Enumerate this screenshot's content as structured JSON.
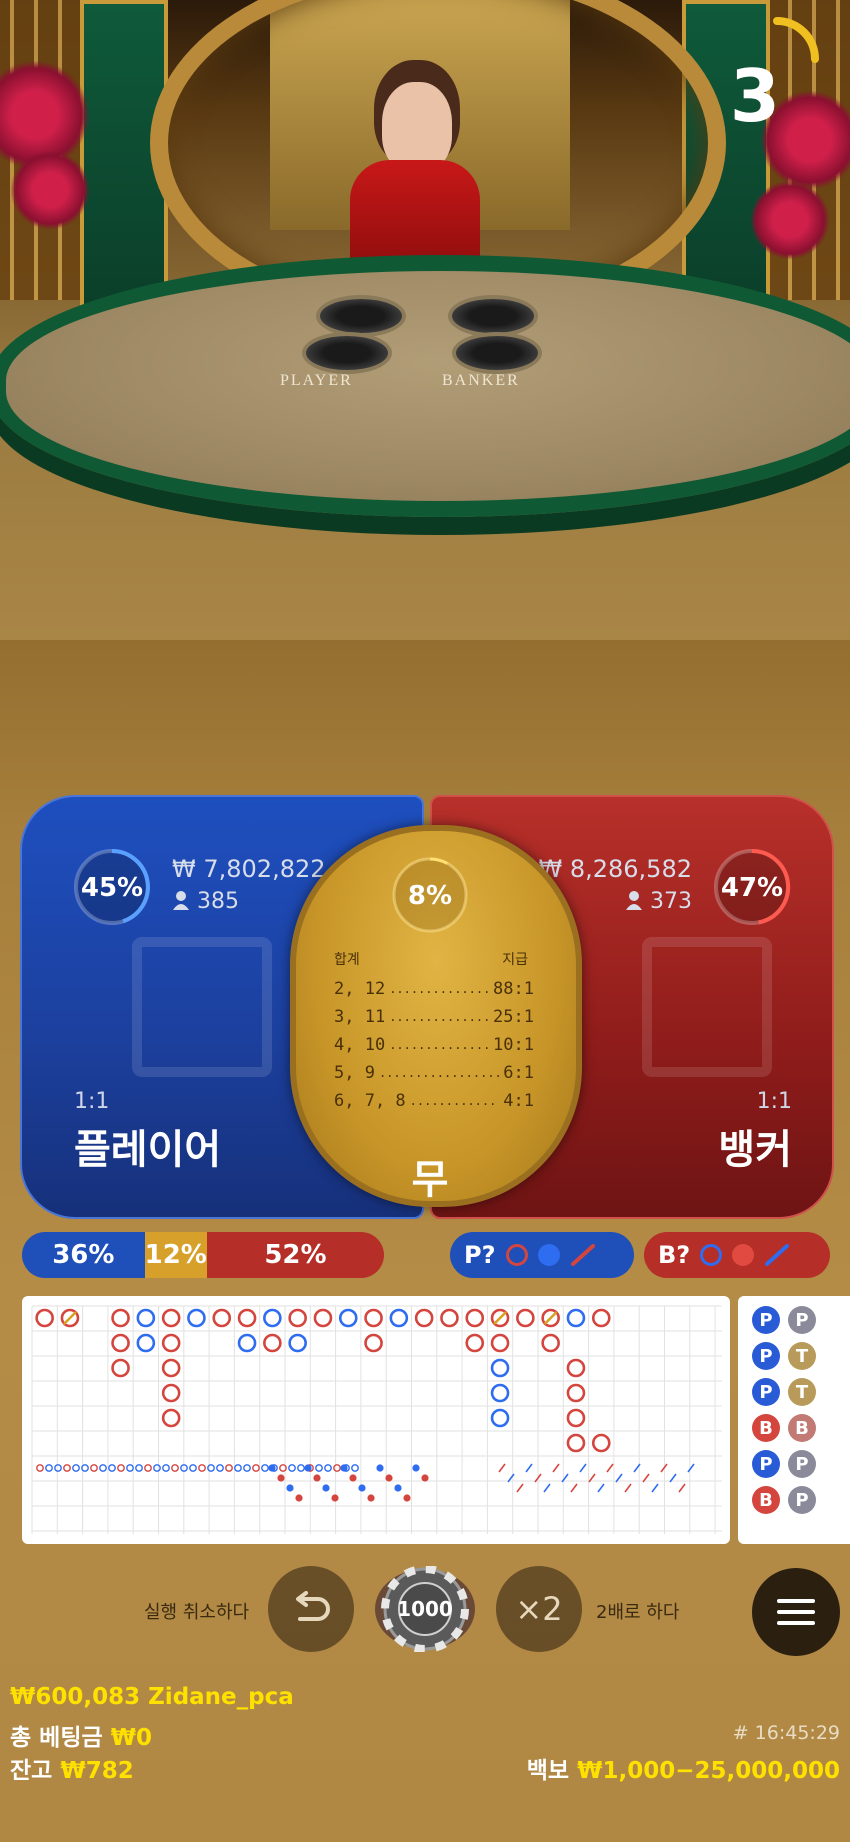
{
  "timer": {
    "seconds": "3",
    "progress": 0.25
  },
  "table_labels": {
    "player": "PLAYER",
    "banker": "BANKER"
  },
  "player": {
    "percent": "45%",
    "percent_value": 0.45,
    "amount": "₩ 7,802,822",
    "bettors": "385",
    "odds": "1:1",
    "label": "플레이어"
  },
  "banker": {
    "percent": "47%",
    "percent_value": 0.47,
    "amount": "₩ 8,286,582",
    "bettors": "373",
    "odds": "1:1",
    "label": "뱅커"
  },
  "tie": {
    "percent": "8%",
    "percent_value": 0.08,
    "header_left": "합계",
    "header_right": "지급",
    "rows": [
      {
        "sum": "2, 12",
        "dots": "...............",
        "pay": "88:1"
      },
      {
        "sum": "3, 11",
        "dots": "...............",
        "pay": "25:1"
      },
      {
        "sum": "4, 10",
        "dots": "...............",
        "pay": "10:1"
      },
      {
        "sum": "5, 9",
        "dots": "...................",
        "pay": "6:1"
      },
      {
        "sum": "6, 7, 8",
        "dots": "..............",
        "pay": "4:1"
      }
    ],
    "label": "무"
  },
  "stats": {
    "player": "36%",
    "tie": "12%",
    "banker": "52%"
  },
  "predict": {
    "player_label": "P?",
    "banker_label": "B?"
  },
  "colors": {
    "player": "#1f55c8",
    "banker": "#c23a34",
    "tie": "#d7a02a",
    "text_yellow": "#ffe100"
  },
  "bead_road": [
    {
      "label": "P",
      "color": "#2a5bd7",
      "next": "P"
    },
    {
      "label": "P",
      "color": "#2a5bd7",
      "next": "T"
    },
    {
      "label": "P",
      "color": "#2a5bd7",
      "next": "T"
    },
    {
      "label": "B",
      "color": "#d4453e",
      "next": "B"
    },
    {
      "label": "P",
      "color": "#2a5bd7",
      "next": "P"
    },
    {
      "label": "B",
      "color": "#d4453e",
      "next": "P"
    }
  ],
  "controls": {
    "undo_label": "실행 취소하다",
    "chip_value": "1000",
    "double_icon": "×2",
    "double_label": "2배로 하다"
  },
  "footer": {
    "balance_line": "₩600,083 Zidane_pca",
    "total_bet_label": "총 베팅금",
    "total_bet_value": "₩0",
    "balance_label": "잔고",
    "balance_value": "₩782",
    "round_id": "# 16:45:29",
    "limit_label": "백보",
    "limit_value": "₩1,000−25,000,000"
  }
}
